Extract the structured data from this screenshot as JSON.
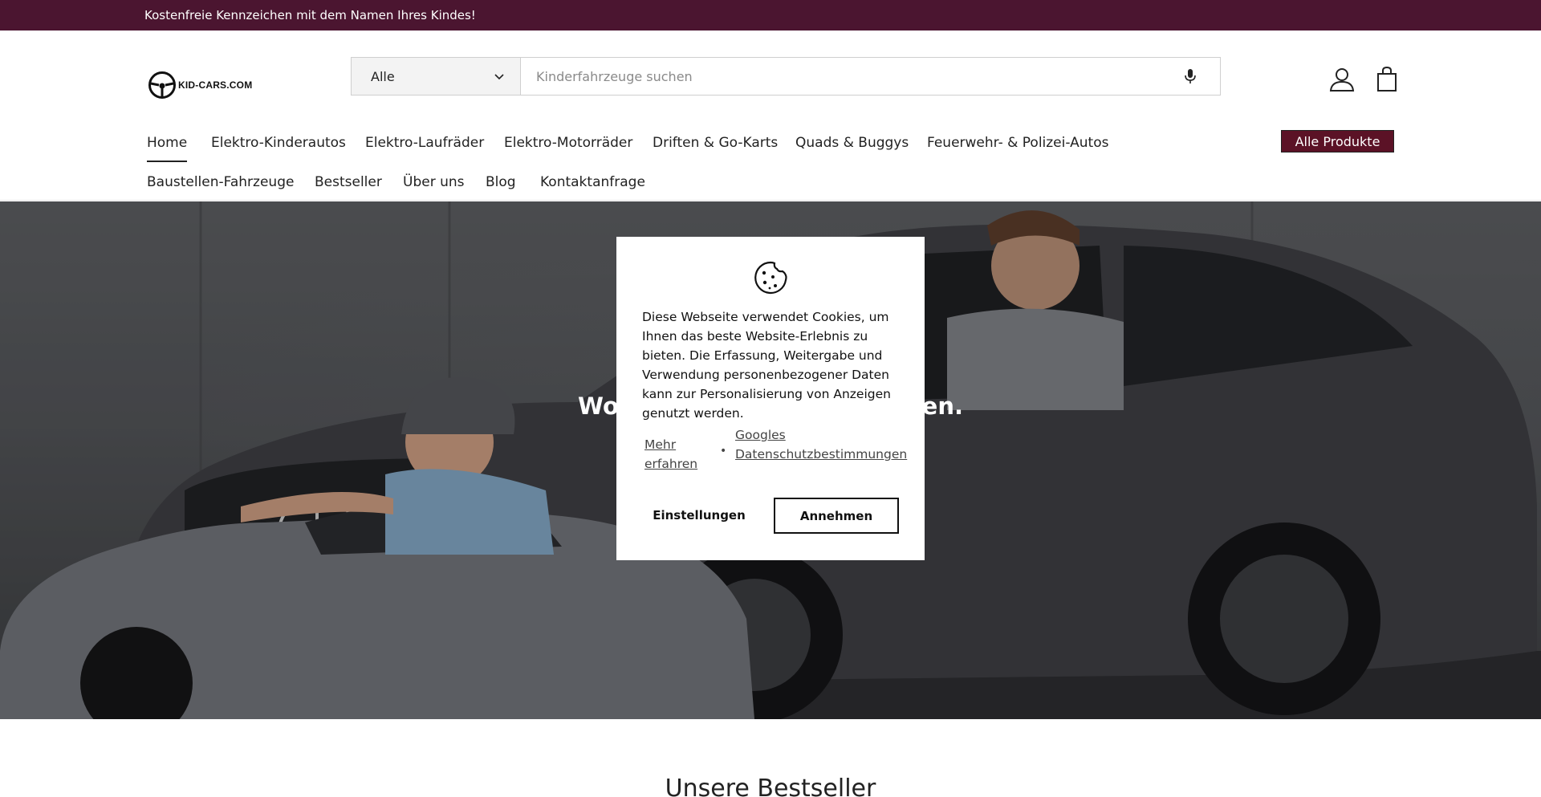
{
  "announcement": {
    "text": "Kostenfreie Kennzeichen mit dem Namen Ihres Kindes!"
  },
  "logo": {
    "text": "KID-CARS.COM"
  },
  "search": {
    "category": "Alle",
    "placeholder": "Kinderfahrzeuge suchen"
  },
  "nav": {
    "row1": [
      "Home",
      "Elektro-Kinderautos",
      "Elektro-Laufräder",
      "Elektro-Motorräder",
      "Driften & Go-Karts",
      "Quads & Buggys",
      "Feuerwehr- & Polizei-Autos"
    ],
    "row2": [
      "Baustellen-Fahrzeuge",
      "Bestseller",
      "Über uns",
      "Blog",
      "Kontaktanfrage"
    ],
    "active": "Home",
    "all_products": "Alle Produkte"
  },
  "hero": {
    "title_visible": "Wo K",
    "title_visible_end": "men."
  },
  "section": {
    "bestseller_title": "Unsere Bestseller"
  },
  "cookie": {
    "text": "Diese Webseite verwendet Cookies, um Ihnen das beste Website-Erlebnis zu bieten. Die Erfassung, Weitergabe und Verwendung personenbezogener Daten kann zur Personalisierung von Anzeigen genutzt werden.",
    "link_more": "Mehr erfahren",
    "link_google": "Googles Datenschutzbestimmungen",
    "settings": "Einstellungen",
    "accept": "Annehmen"
  },
  "colors": {
    "announcement_bg": "#4b1530",
    "all_products_bg": "#5b1226"
  },
  "icons": {
    "search_category": "chevron-down-icon",
    "mic": "microphone-icon",
    "account": "user-icon",
    "cart": "shopping-bag-icon",
    "cookie": "cookie-icon"
  }
}
